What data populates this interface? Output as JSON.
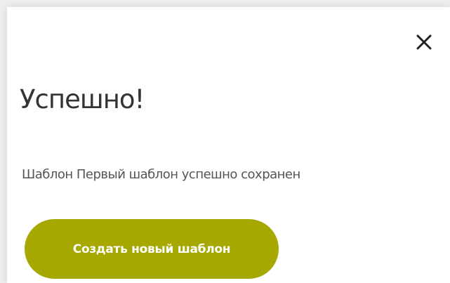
{
  "dialog": {
    "title": "Успешно!",
    "message": "Шаблон Первый шаблон успешно сохранен",
    "close_icon": "close-icon",
    "create_button_label": "Создать новый шаблон"
  },
  "colors": {
    "accent": "#a6a800",
    "title_text": "#333333",
    "message_text": "#555555",
    "background": "#ffffff"
  }
}
